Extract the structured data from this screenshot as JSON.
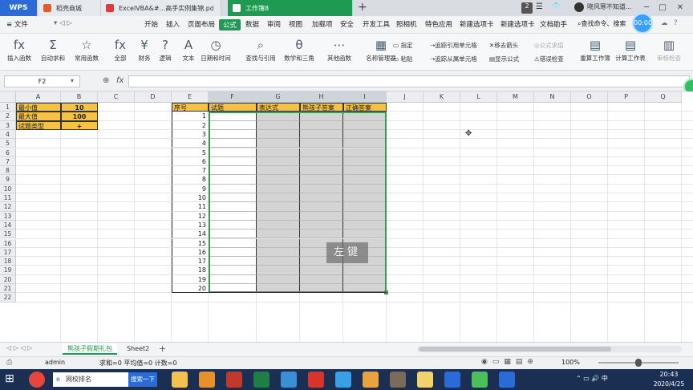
{
  "titlebar": {
    "app": "WPS",
    "tabs": [
      {
        "label": "稻壳商城",
        "color": "#e55a2b"
      },
      {
        "label": "ExcelVBA&#...高手实例集锦.pdf",
        "color": "#e03a3a"
      },
      {
        "label": "工作簿8",
        "color": "#1e9a52"
      }
    ],
    "page_num": "2",
    "user": "晓风寒不知道..."
  },
  "menubar": {
    "file": "≡ 文件",
    "items": [
      "开始",
      "插入",
      "页面布局",
      "公式",
      "数据",
      "审阅",
      "视图",
      "加载项",
      "安全",
      "开发工具",
      "照相机",
      "特色应用",
      "新建选项卡",
      "新建选项卡",
      "文档助手"
    ],
    "active": "公式",
    "search": "查找命令、搜索",
    "timer": "00:00"
  },
  "ribbon": {
    "big_buttons": [
      {
        "label": "插入函数",
        "glyph": "fx"
      },
      {
        "label": "自动求和",
        "glyph": "Σ"
      },
      {
        "label": "常用函数",
        "glyph": "☆"
      },
      {
        "label": "全部",
        "glyph": "fx"
      },
      {
        "label": "财务",
        "glyph": "¥"
      },
      {
        "label": "逻辑",
        "glyph": "?"
      },
      {
        "label": "文本",
        "glyph": "A"
      },
      {
        "label": "日期和时间",
        "glyph": "◷"
      },
      {
        "label": "查找与引用",
        "glyph": "⌕"
      },
      {
        "label": "数学和三角",
        "glyph": "θ"
      },
      {
        "label": "其他函数",
        "glyph": "⋯"
      },
      {
        "label": "名称管理器",
        "glyph": "▦"
      }
    ],
    "mid_small": [
      "指定",
      "粘贴"
    ],
    "trace": [
      "追踪引用单元格",
      "追踪从属单元格",
      "移去箭头",
      "显示公式",
      "公式求值",
      "错误检查"
    ],
    "right_buttons": [
      {
        "label": "重算工作簿",
        "glyph": "▤"
      },
      {
        "label": "计算工作表",
        "glyph": "▤"
      },
      {
        "label": "审核检查",
        "glyph": "▥"
      }
    ]
  },
  "formula_bar": {
    "name_box": "F2",
    "fx": "fx",
    "value": ""
  },
  "sheet": {
    "columns": [
      "A",
      "B",
      "C",
      "D",
      "E",
      "F",
      "G",
      "H",
      "I",
      "J",
      "K",
      "L",
      "M",
      "N",
      "O",
      "P",
      "Q"
    ],
    "selected_columns": [
      "F",
      "G",
      "H",
      "I"
    ],
    "rows": 22,
    "params": [
      {
        "label": "最小值",
        "value": "10"
      },
      {
        "label": "最大值",
        "value": "100"
      },
      {
        "label": "试题类型",
        "value": "+"
      }
    ],
    "table_headers": [
      "序号",
      "试题",
      "表达式",
      "熊孩子答案",
      "正确答案"
    ],
    "serials": [
      "1",
      "2",
      "3",
      "4",
      "5",
      "6",
      "7",
      "8",
      "9",
      "10",
      "11",
      "12",
      "13",
      "14",
      "15",
      "16",
      "17",
      "18",
      "19",
      "20"
    ],
    "watermark": "左键"
  },
  "sheet_tabs": {
    "tabs": [
      "熊孩子假期礼包",
      "Sheet2"
    ],
    "add": "+"
  },
  "statusbar": {
    "user": "admin",
    "summary": "求和=0  平均值=0  计数=0",
    "zoom": "100%"
  },
  "taskbar": {
    "search_label": "网校排名",
    "search_button": "搜索一下",
    "time": "20:43",
    "date": "2020/4/25"
  },
  "colors": {
    "accent_green": "#1e9a52",
    "param_fill": "#f5c242",
    "table_header_fill": "#f5c242",
    "table_body_fill": "#d4d4d4"
  }
}
